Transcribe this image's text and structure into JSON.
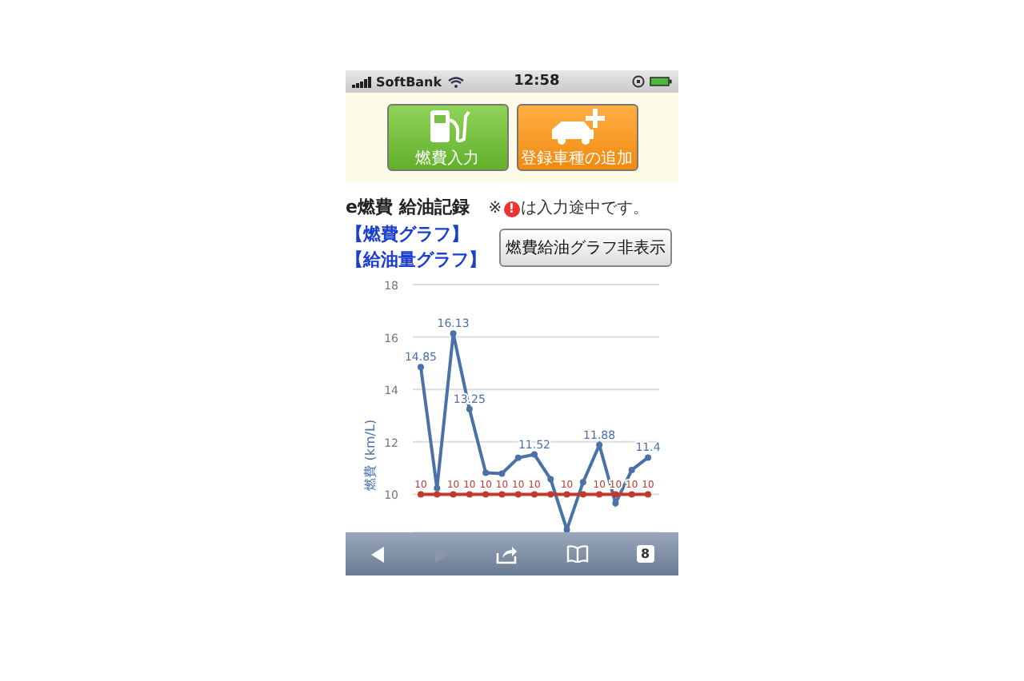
{
  "status_bar": {
    "carrier": "SoftBank",
    "time": "12:58"
  },
  "top_buttons": [
    {
      "label": "燃費入力",
      "kind": "fuel"
    },
    {
      "label": "登録車種の追加",
      "kind": "car"
    }
  ],
  "heading": {
    "title": "e燃費 給油記録",
    "note_before": "※",
    "note_mark": "!",
    "note_after": "は入力途中です。"
  },
  "links": [
    "【燃費グラフ】",
    "【給油量グラフ】"
  ],
  "toggle_button": "燃費給油グラフ非表示",
  "chart_data": {
    "type": "line",
    "ylabel": "燃費 (km/L)",
    "ylim": [
      8.5,
      18
    ],
    "yticks": [
      10,
      12,
      14,
      16,
      18
    ],
    "grid": true,
    "series": [
      {
        "color": "#4a72a8",
        "marker": "circle",
        "values": [
          14.85,
          10.23,
          16.13,
          13.25,
          10.82,
          10.79,
          11.39,
          11.52,
          10.58,
          8.65,
          10.46,
          11.88,
          9.66,
          10.93,
          11.4
        ],
        "value_labels": [
          "14.85",
          null,
          "16.13",
          "13.25",
          null,
          null,
          null,
          "11.52",
          null,
          null,
          null,
          "11.88",
          null,
          null,
          "11.4"
        ]
      },
      {
        "color": "#c0392b",
        "marker": "circle",
        "values": [
          10,
          10,
          10,
          10,
          10,
          10,
          10,
          10,
          10,
          10,
          10,
          10,
          10,
          10,
          10
        ],
        "value_labels": [
          "10",
          null,
          "10",
          "10",
          "10",
          "10",
          "10",
          "10",
          null,
          "10",
          null,
          "10",
          "10",
          "10",
          "10"
        ]
      }
    ]
  },
  "toolbar": {
    "tab_count": "8"
  }
}
